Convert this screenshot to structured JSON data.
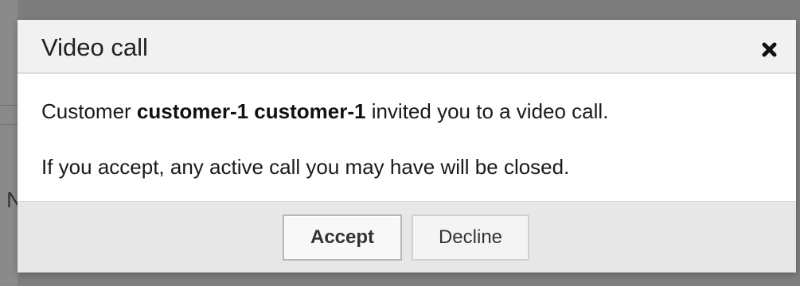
{
  "backdrop": {
    "partial_glyph": "N"
  },
  "dialog": {
    "title": "Video call",
    "close_icon": "close-icon",
    "body": {
      "line1_prefix": "Customer ",
      "line1_name": "customer-1 customer-1",
      "line1_suffix": " invited you to a video call.",
      "line2": "If you accept, any active call you may have will be closed."
    },
    "buttons": {
      "accept_label": "Accept",
      "decline_label": "Decline"
    }
  },
  "colors": {
    "backdrop": "#7d7d7d",
    "header_bg": "#f1f1f1",
    "footer_bg": "#e7e7e7",
    "text": "#1a1a1a"
  }
}
